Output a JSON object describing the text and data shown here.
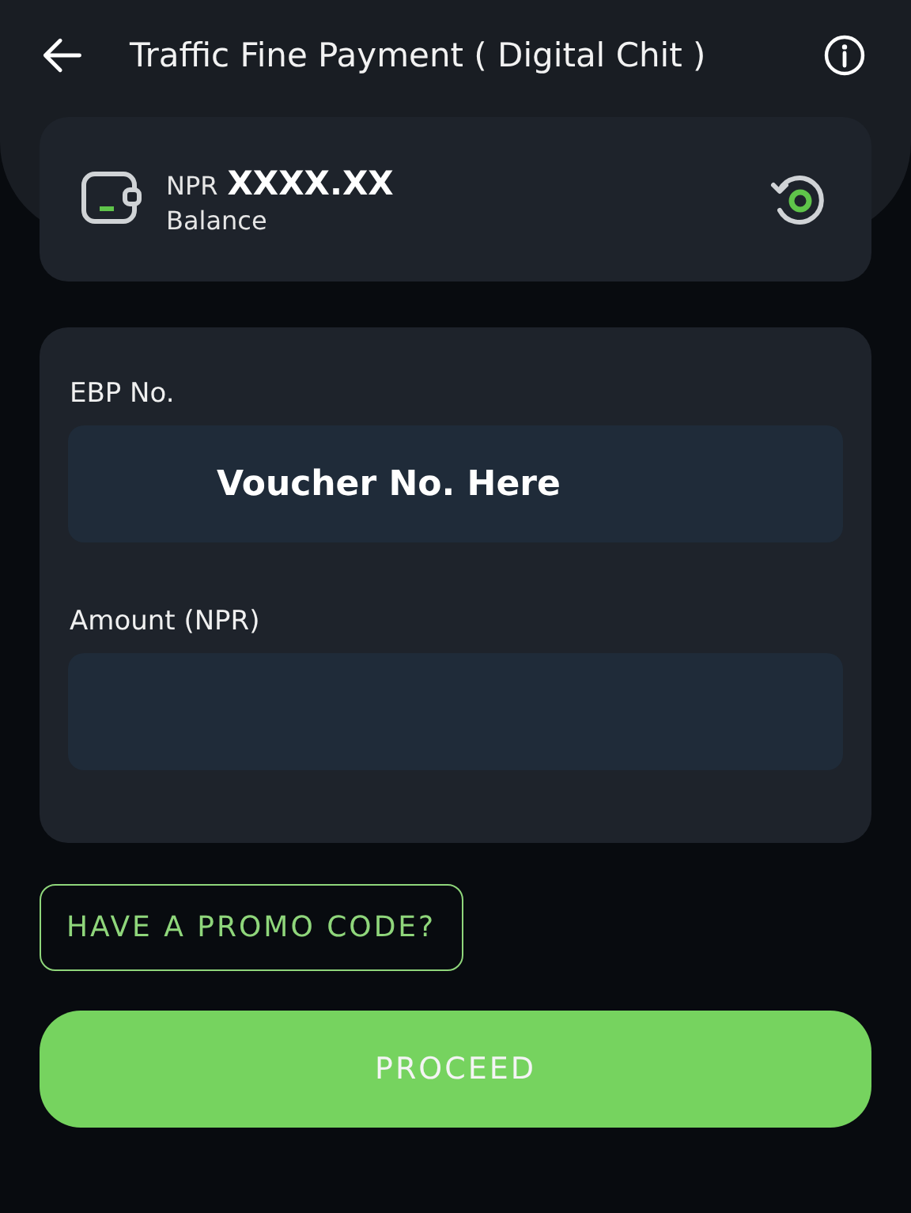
{
  "header": {
    "title": "Traffic Fine Payment ( Digital Chit )"
  },
  "balance": {
    "currency": "NPR",
    "amount": "XXXX.XX",
    "label": "Balance"
  },
  "form": {
    "fields": [
      {
        "label": "EBP No.",
        "value": "Voucher No. Here"
      },
      {
        "label": "Amount (NPR)"
      }
    ]
  },
  "promo_button": "HAVE A PROMO CODE?",
  "proceed_button": "PROCEED"
}
